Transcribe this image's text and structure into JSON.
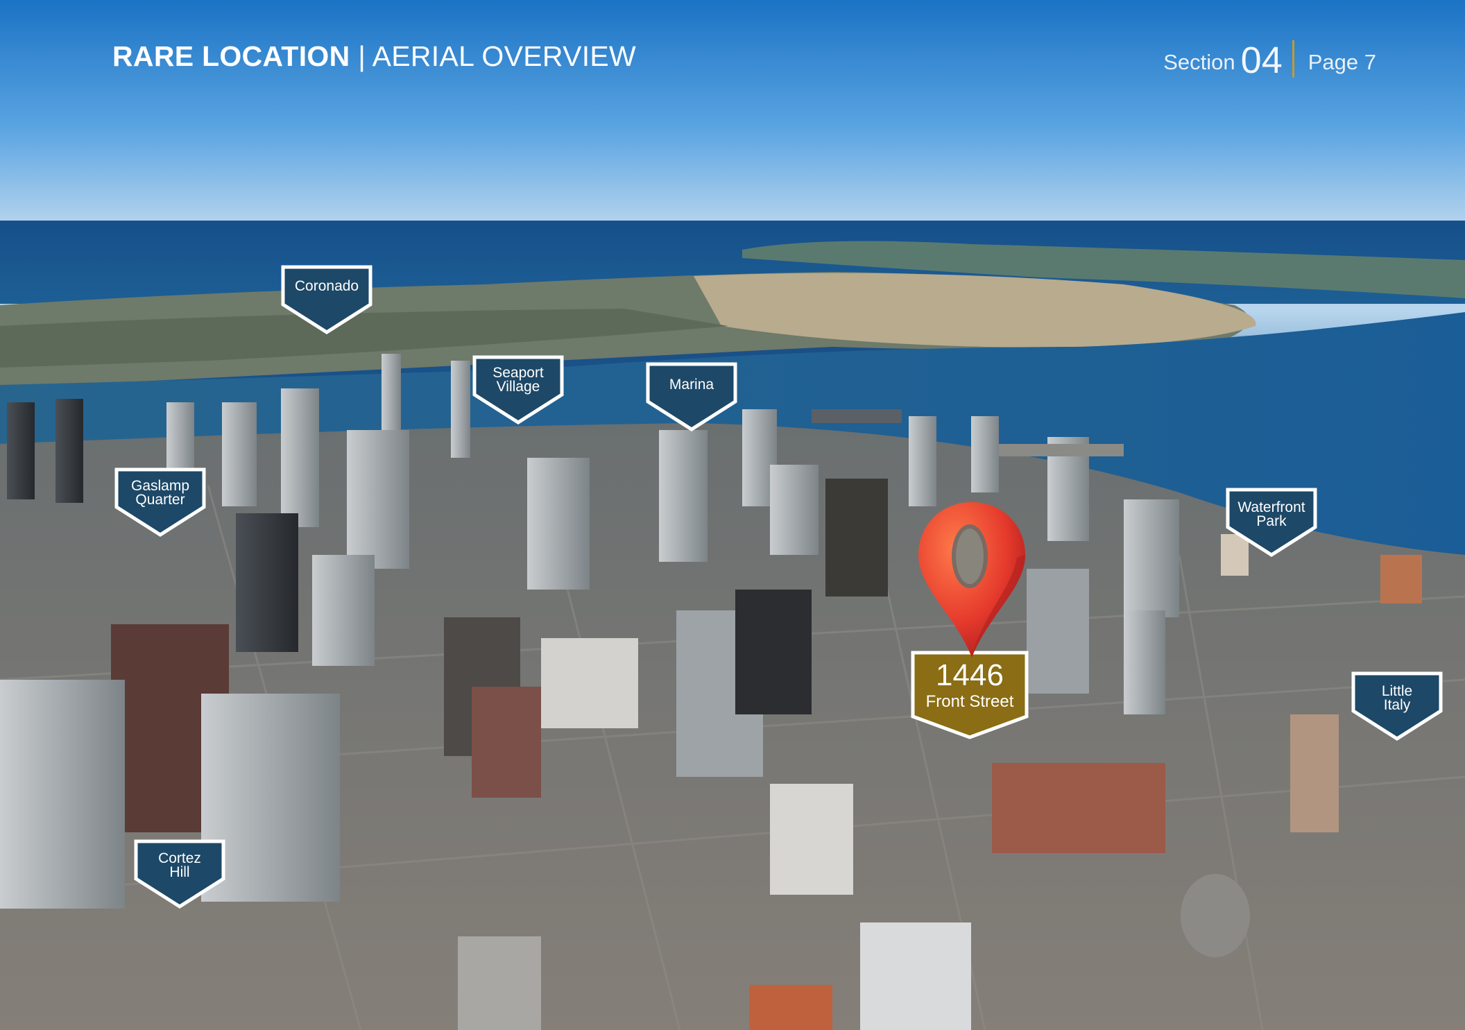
{
  "header": {
    "title_bold": "RARE LOCATION",
    "separator": "|",
    "title_rest": "AERIAL OVERVIEW"
  },
  "section_nav": {
    "section_label": "Section",
    "section_number": "04",
    "page_label": "Page 7"
  },
  "neighborhoods": [
    {
      "line1": "Coronado",
      "line2": ""
    },
    {
      "line1": "Seaport",
      "line2": "Village"
    },
    {
      "line1": "Marina",
      "line2": ""
    },
    {
      "line1": "Gaslamp",
      "line2": "Quarter"
    },
    {
      "line1": "Waterfront",
      "line2": "Park"
    },
    {
      "line1": "Little",
      "line2": "Italy"
    },
    {
      "line1": "Cortez",
      "line2": "Hill"
    }
  ],
  "property": {
    "number": "1446",
    "street": "Front Street",
    "pin_icon": "map-pin-icon"
  },
  "colors": {
    "marker_fill": "#1d4867",
    "marker_border": "#ffffff",
    "property_fill": "#8a6d14",
    "pin_red": "#e2402f",
    "accent_gold": "#c79a2a"
  }
}
